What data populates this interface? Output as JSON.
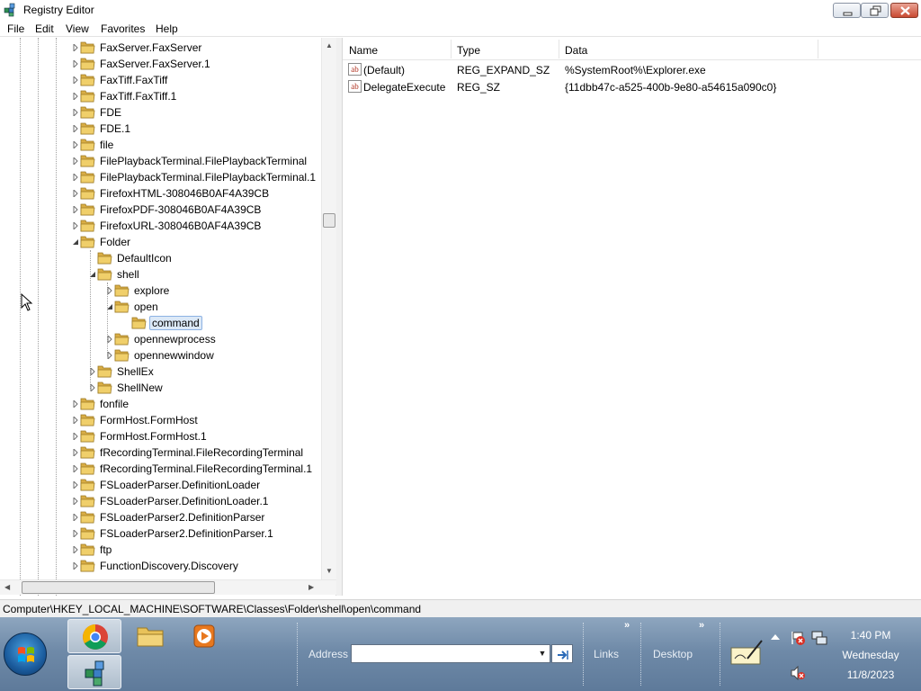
{
  "window": {
    "title": "Registry Editor"
  },
  "menu": [
    "File",
    "Edit",
    "View",
    "Favorites",
    "Help"
  ],
  "tree": {
    "items": [
      {
        "label": "FaxServer.FaxServer",
        "level": 0,
        "expander": "collapsed"
      },
      {
        "label": "FaxServer.FaxServer.1",
        "level": 0,
        "expander": "collapsed"
      },
      {
        "label": "FaxTiff.FaxTiff",
        "level": 0,
        "expander": "collapsed"
      },
      {
        "label": "FaxTiff.FaxTiff.1",
        "level": 0,
        "expander": "collapsed"
      },
      {
        "label": "FDE",
        "level": 0,
        "expander": "collapsed"
      },
      {
        "label": "FDE.1",
        "level": 0,
        "expander": "collapsed"
      },
      {
        "label": "file",
        "level": 0,
        "expander": "collapsed"
      },
      {
        "label": "FilePlaybackTerminal.FilePlaybackTerminal",
        "level": 0,
        "expander": "collapsed"
      },
      {
        "label": "FilePlaybackTerminal.FilePlaybackTerminal.1",
        "level": 0,
        "expander": "collapsed"
      },
      {
        "label": "FirefoxHTML-308046B0AF4A39CB",
        "level": 0,
        "expander": "collapsed"
      },
      {
        "label": "FirefoxPDF-308046B0AF4A39CB",
        "level": 0,
        "expander": "collapsed"
      },
      {
        "label": "FirefoxURL-308046B0AF4A39CB",
        "level": 0,
        "expander": "collapsed"
      },
      {
        "label": "Folder",
        "level": 0,
        "expander": "expanded"
      },
      {
        "label": "DefaultIcon",
        "level": 1,
        "expander": "none"
      },
      {
        "label": "shell",
        "level": 1,
        "expander": "expanded"
      },
      {
        "label": "explore",
        "level": 2,
        "expander": "collapsed"
      },
      {
        "label": "open",
        "level": 2,
        "expander": "expanded"
      },
      {
        "label": "command",
        "level": 3,
        "expander": "none",
        "selected": true
      },
      {
        "label": "opennewprocess",
        "level": 2,
        "expander": "collapsed"
      },
      {
        "label": "opennewwindow",
        "level": 2,
        "expander": "collapsed"
      },
      {
        "label": "ShellEx",
        "level": 1,
        "expander": "collapsed"
      },
      {
        "label": "ShellNew",
        "level": 1,
        "expander": "collapsed"
      },
      {
        "label": "fonfile",
        "level": 0,
        "expander": "collapsed"
      },
      {
        "label": "FormHost.FormHost",
        "level": 0,
        "expander": "collapsed"
      },
      {
        "label": "FormHost.FormHost.1",
        "level": 0,
        "expander": "collapsed"
      },
      {
        "label": "fRecordingTerminal.FileRecordingTerminal",
        "level": 0,
        "expander": "collapsed"
      },
      {
        "label": "fRecordingTerminal.FileRecordingTerminal.1",
        "level": 0,
        "expander": "collapsed"
      },
      {
        "label": "FSLoaderParser.DefinitionLoader",
        "level": 0,
        "expander": "collapsed"
      },
      {
        "label": "FSLoaderParser.DefinitionLoader.1",
        "level": 0,
        "expander": "collapsed"
      },
      {
        "label": "FSLoaderParser2.DefinitionParser",
        "level": 0,
        "expander": "collapsed"
      },
      {
        "label": "FSLoaderParser2.DefinitionParser.1",
        "level": 0,
        "expander": "collapsed"
      },
      {
        "label": "ftp",
        "level": 0,
        "expander": "collapsed"
      },
      {
        "label": "FunctionDiscovery.Discovery",
        "level": 0,
        "expander": "collapsed"
      }
    ]
  },
  "list": {
    "columns": [
      "Name",
      "Type",
      "Data"
    ],
    "rows": [
      {
        "name": "(Default)",
        "type": "REG_EXPAND_SZ",
        "data": "%SystemRoot%\\Explorer.exe",
        "icon": "string-value-icon"
      },
      {
        "name": "DelegateExecute",
        "type": "REG_SZ",
        "data": "{11dbb47c-a525-400b-9e80-a54615a090c0}",
        "icon": "string-value-icon"
      }
    ]
  },
  "status": {
    "path": "Computer\\HKEY_LOCAL_MACHINE\\SOFTWARE\\Classes\\Folder\\shell\\open\\command"
  },
  "taskbar": {
    "address_label": "Address",
    "address_value": "",
    "links_label": "Links",
    "desktop_label": "Desktop",
    "pinned": [
      "chrome-icon",
      "folder-icon",
      "media-player-icon",
      "registry-editor-icon"
    ]
  },
  "clock": {
    "time": "1:40 PM",
    "day": "Wednesday",
    "date": "11/8/2023"
  },
  "colors": {
    "selection": "#dce9f7",
    "taskbar": "#6f8aa8",
    "folder": "#e8c25a"
  }
}
